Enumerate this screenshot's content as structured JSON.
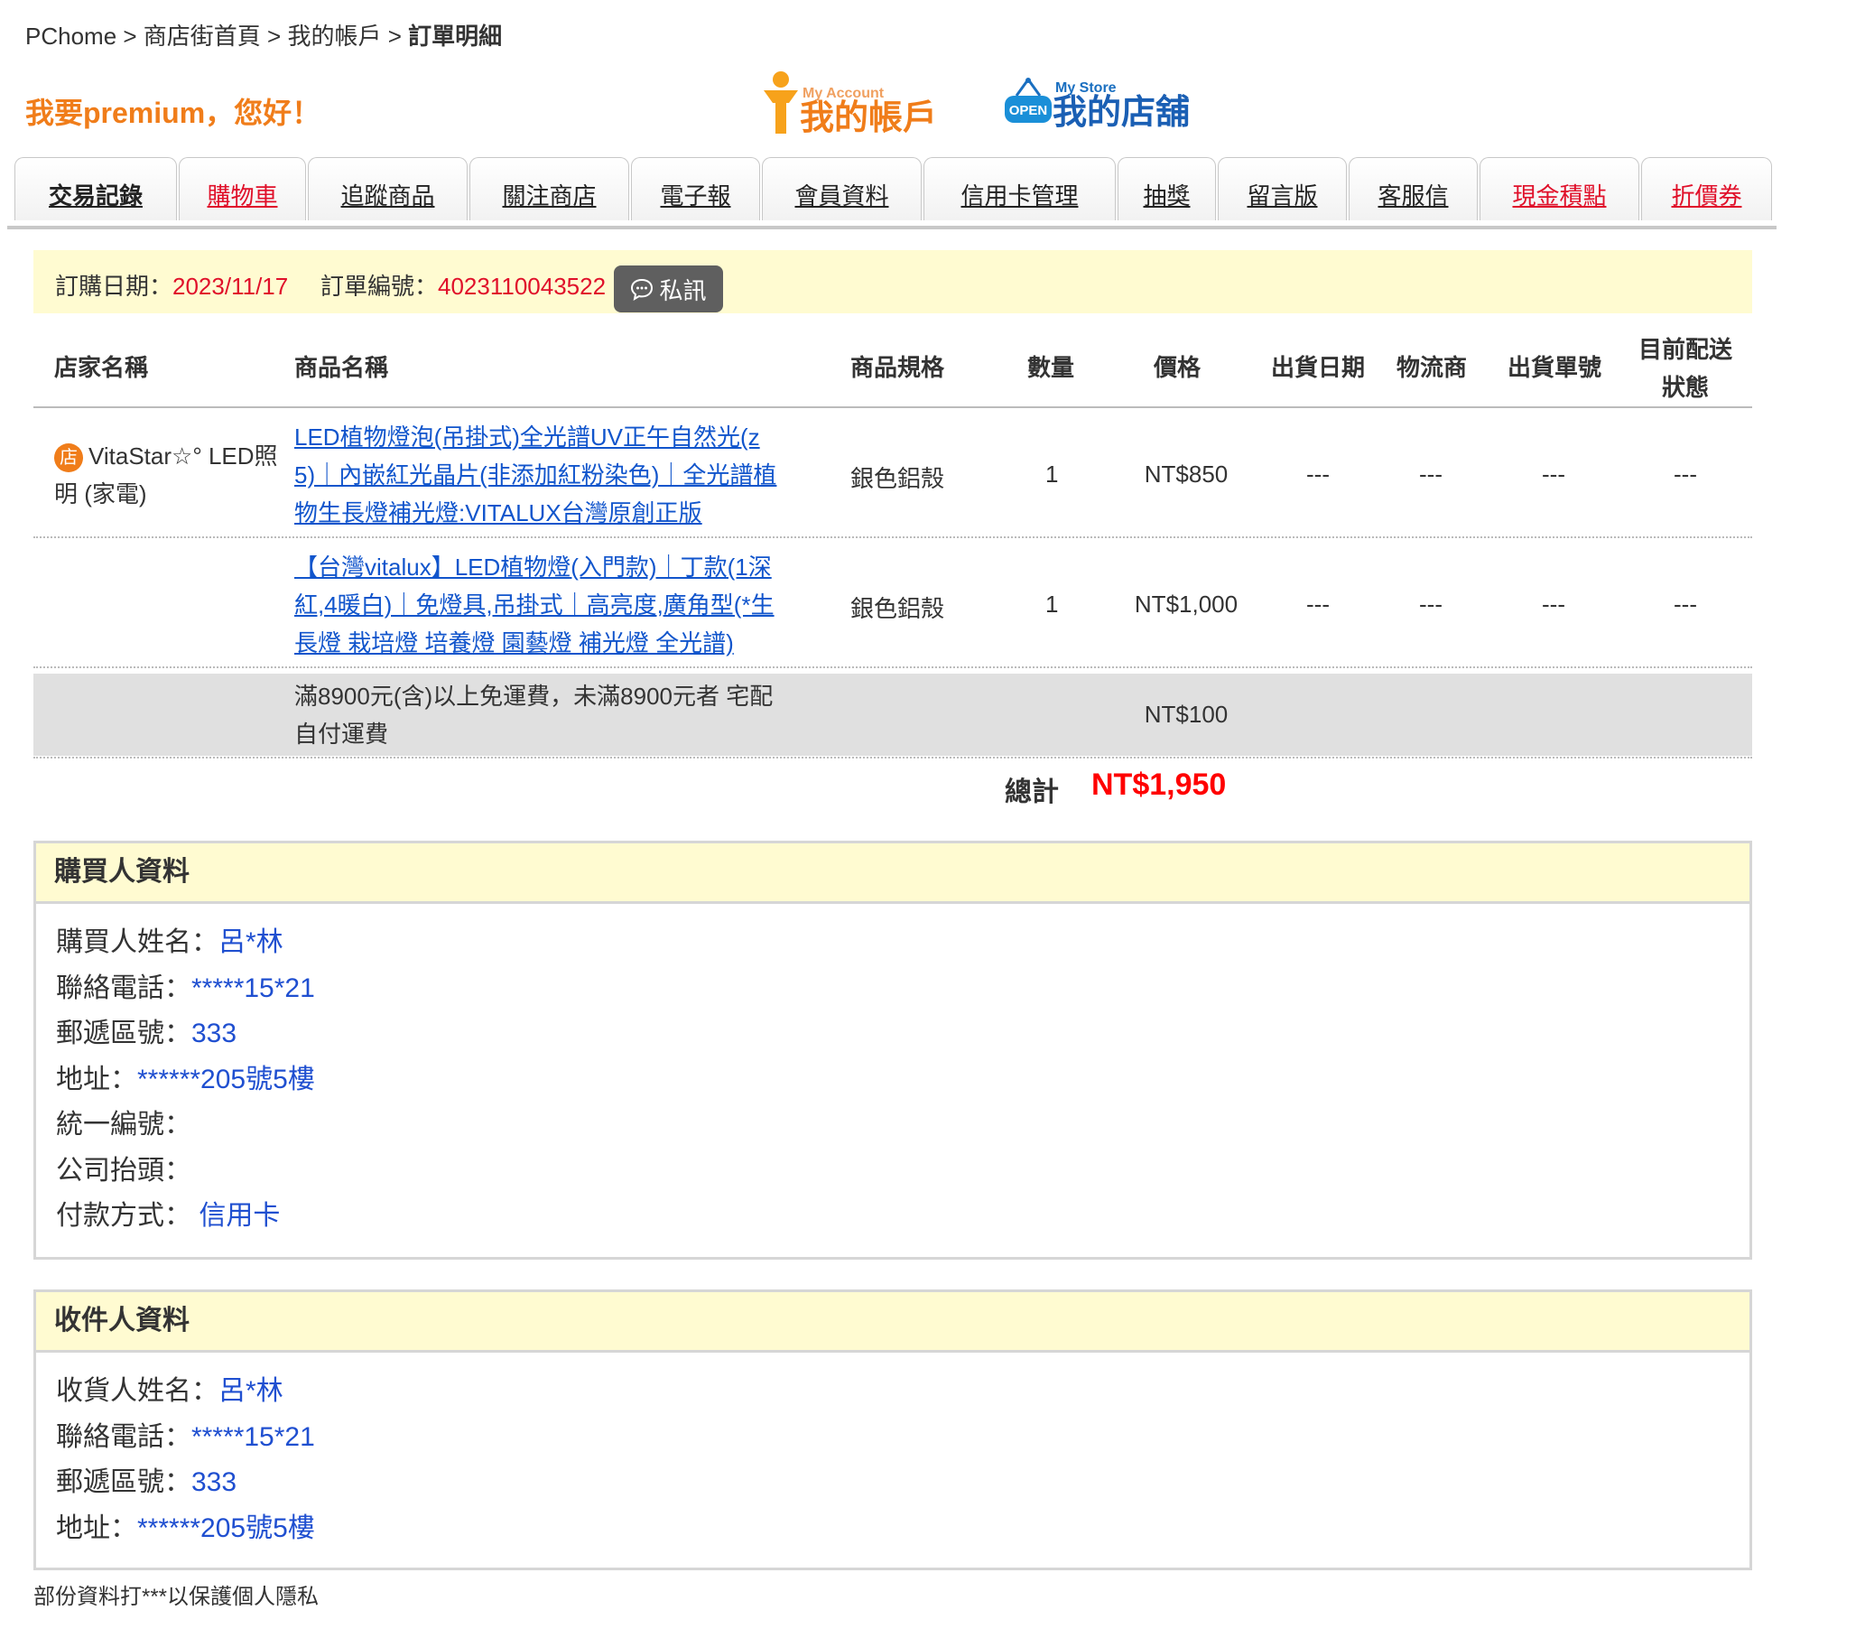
{
  "breadcrumb": {
    "items": [
      "PChome",
      "商店街首頁",
      "我的帳戶"
    ],
    "current": "訂單明細",
    "sep": " > "
  },
  "greeting": "我要premium，您好！",
  "logos": {
    "account": {
      "small": "My Account",
      "big": "我的帳戶"
    },
    "store": {
      "small": "My Store",
      "badge": "OPEN",
      "big": "我的店舖"
    }
  },
  "tabs": [
    {
      "label": "交易記錄",
      "red": false,
      "active": true
    },
    {
      "label": "購物車",
      "red": true,
      "active": false
    },
    {
      "label": "追蹤商品",
      "red": false,
      "active": false
    },
    {
      "label": "關注商店",
      "red": false,
      "active": false
    },
    {
      "label": "電子報",
      "red": false,
      "active": false
    },
    {
      "label": "會員資料",
      "red": false,
      "active": false
    },
    {
      "label": "信用卡管理",
      "red": false,
      "active": false
    },
    {
      "label": "抽獎",
      "red": false,
      "active": false
    },
    {
      "label": "留言版",
      "red": false,
      "active": false
    },
    {
      "label": "客服信",
      "red": false,
      "active": false
    },
    {
      "label": "現金積點",
      "red": true,
      "active": false
    },
    {
      "label": "折價券",
      "red": true,
      "active": false
    }
  ],
  "order": {
    "date_label": "訂購日期：",
    "date": "2023/11/17",
    "no_label": "訂單編號：",
    "no": "4023110043522",
    "message_button": "私訊"
  },
  "table": {
    "headers": {
      "store": "店家名稱",
      "product": "商品名稱",
      "spec": "商品規格",
      "qty": "數量",
      "price": "價格",
      "ship_date": "出貨日期",
      "carrier": "物流商",
      "ship_no": "出貨單號",
      "status_1": "目前配送",
      "status_2": "狀態"
    },
    "store": {
      "badge": "店",
      "name_1": "VitaStar☆° LED照",
      "name_2": "明 (家電)"
    },
    "rows": [
      {
        "product_lines": [
          "LED植物燈泡(吊掛式)全光譜UV正午自然光(z",
          "5)｜內嵌紅光晶片(非添加紅粉染色)｜全光譜植",
          "物生長燈補光燈:VITALUX台灣原創正版"
        ],
        "spec": "銀色鋁殼",
        "qty": "1",
        "price": "NT$850",
        "ship_date": "---",
        "carrier": "---",
        "ship_no": "---",
        "status": "---"
      },
      {
        "product_lines": [
          "【台灣vitalux】LED植物燈(入門款)｜丁款(1深",
          "紅,4暖白)｜免燈具,吊掛式｜高亮度,廣角型(*生",
          "長燈 栽培燈 培養燈 園藝燈 補光燈 全光譜)"
        ],
        "spec": "銀色鋁殼",
        "qty": "1",
        "price": "NT$1,000",
        "ship_date": "---",
        "carrier": "---",
        "ship_no": "---",
        "status": "---"
      }
    ],
    "shipping": {
      "text_1": "滿8900元(含)以上免運費，未滿8900元者 宅配",
      "text_2": "自付運費",
      "price": "NT$100"
    },
    "total_label": "總計",
    "total": "NT$1,950"
  },
  "buyer": {
    "title": "購買人資料",
    "fields": [
      {
        "label": "購買人姓名：",
        "value": "呂*林"
      },
      {
        "label": "聯絡電話：",
        "value": "*****15*21"
      },
      {
        "label": "郵遞區號：",
        "value": "333"
      },
      {
        "label": "地址：",
        "value": "******205號5樓"
      },
      {
        "label": "統一編號：",
        "value": ""
      },
      {
        "label": "公司抬頭：",
        "value": ""
      },
      {
        "label": "付款方式：",
        "value": " 信用卡"
      }
    ]
  },
  "receiver": {
    "title": "收件人資料",
    "fields": [
      {
        "label": "收貨人姓名：",
        "value": "呂*林"
      },
      {
        "label": "聯絡電話：",
        "value": "*****15*21"
      },
      {
        "label": "郵遞區號：",
        "value": "333"
      },
      {
        "label": "地址：",
        "value": "******205號5樓"
      }
    ]
  },
  "footnote": "部份資料打***以保護個人隱私"
}
